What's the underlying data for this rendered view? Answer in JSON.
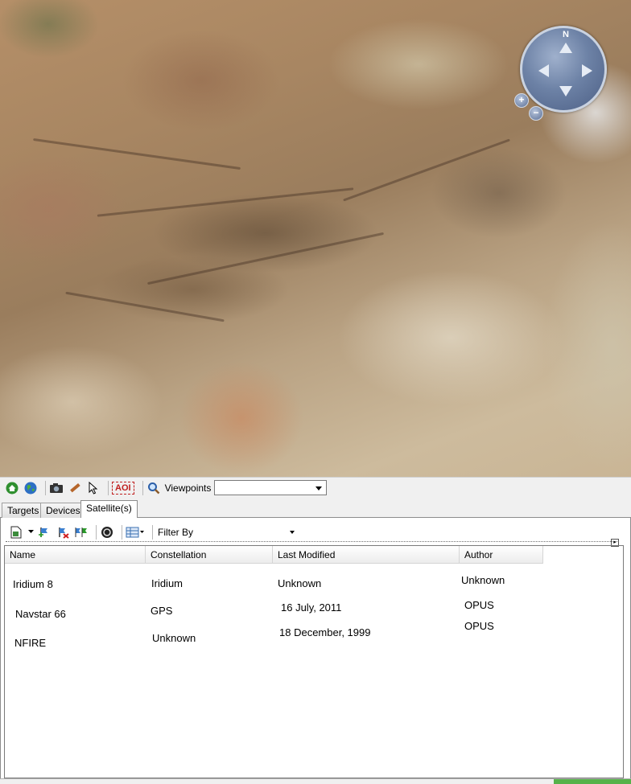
{
  "map": {
    "compass_label": "N",
    "zoom_in_label": "+",
    "zoom_out_label": "−"
  },
  "toolbar": {
    "aoi_label": "AOI",
    "viewpoints_label": "Viewpoints",
    "viewpoints_value": ""
  },
  "tabs": [
    {
      "label": "Targets"
    },
    {
      "label": "Devices"
    },
    {
      "label": "Satellite(s)"
    }
  ],
  "active_tab": "Satellite(s)",
  "subtoolbar": {
    "filter_label": "Filter By"
  },
  "table": {
    "columns": [
      "Name",
      "Constellation",
      "Last Modified",
      "Author"
    ],
    "rows": [
      {
        "name": "Iridium 8",
        "constellation": "Iridium",
        "last_modified": "Unknown",
        "author": "Unknown"
      },
      {
        "name": "Navstar 66",
        "constellation": "GPS",
        "last_modified": "16 July, 2011",
        "author": "OPUS"
      },
      {
        "name": "NFIRE",
        "constellation": "Unknown",
        "last_modified": "18 December, 1999",
        "author": "OPUS"
      }
    ]
  },
  "colors": {
    "status_progress": "#56b24a",
    "aoi_red": "#c02020"
  }
}
